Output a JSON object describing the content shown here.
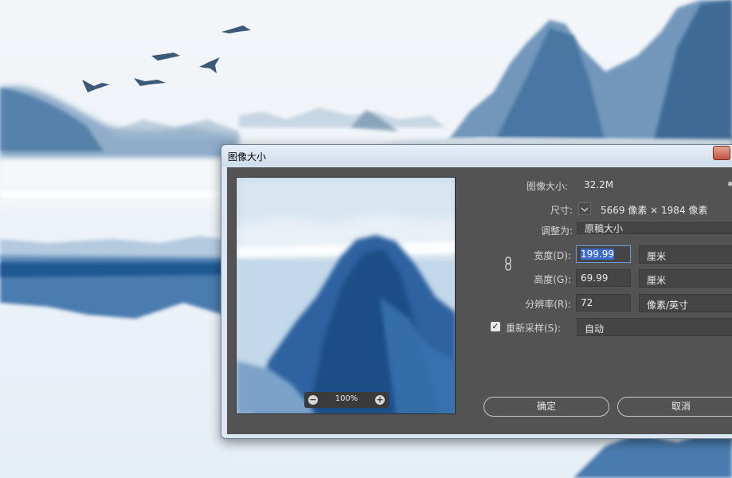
{
  "dialog": {
    "title": "图像大小",
    "image_size_label": "图像大小:",
    "image_size_value": "32.2M",
    "dimensions_label": "尺寸:",
    "dimensions_value": "5669 像素  ×  1984 像素",
    "fit_to_label": "调整为:",
    "fit_to_value": "原稿大小",
    "width_label": "宽度(D):",
    "width_value": "199.99",
    "width_unit": "厘米",
    "height_label": "高度(G):",
    "height_value": "69.99",
    "height_unit": "厘米",
    "resolution_label": "分辨率(R):",
    "resolution_value": "72",
    "resolution_unit": "像素/英寸",
    "resample_label": "重新采样(S):",
    "resample_checked": true,
    "resample_value": "自动",
    "ok_label": "确定",
    "cancel_label": "取消",
    "zoom_level": "100%"
  },
  "icons": {
    "close": "close-icon",
    "gear": "gear-icon",
    "link": "link-icon",
    "chevron": "chevron-down-icon",
    "zoom_out": "zoom-out-icon",
    "zoom_in": "zoom-in-icon",
    "check": "checkbox-icon"
  },
  "colors": {
    "panel": "#535353",
    "selection": "#3b6ccc",
    "focus": "#6d9ad3",
    "close": "#c4523b"
  }
}
